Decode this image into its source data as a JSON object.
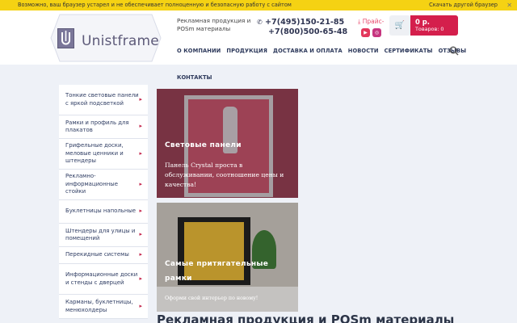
{
  "warning": {
    "message": "Возможно, ваш браузер устарел и не обеспечивает полноценную и безопасную работу с сайтом",
    "link": "Скачать другой браузер",
    "close": "✕"
  },
  "header": {
    "logo_text": "Unistframe",
    "tagline": "Рекламная продукция и POSm материалы",
    "phones": [
      "+7(495)150-21-85",
      "+7(800)500-65-48"
    ],
    "price_link": "Прайс-",
    "social_icons": [
      "youtube-icon",
      "instagram-icon"
    ],
    "cart": {
      "sum": "0 р.",
      "count": "Товаров: 0"
    }
  },
  "nav": {
    "items": [
      "О КОМПАНИИ",
      "ПРОДУКЦИЯ",
      "ДОСТАВКА И ОПЛАТА",
      "НОВОСТИ",
      "СЕРТИФИКАТЫ",
      "ОТЗЫВЫ"
    ],
    "second_row": "КОНТАКТЫ"
  },
  "sidebar": {
    "items": [
      "Тонкие световые панели с яркой подсветкой",
      "Рамки и профиль для плакатов",
      "Грифельные доски, меловые ценники и штендеры",
      "Рекламно-информационные стойки",
      "Буклетницы напольные",
      "Штендеры для улицы и помещений",
      "Перекидные системы",
      "Информационные доски и стенды с дверцей",
      "Карманы, буклетницы, менюхолдеры"
    ]
  },
  "banners": [
    {
      "title": "Световые панели",
      "description": "Панель Crystal проста в обслуживании, соотношение цены и качества!"
    },
    {
      "title": "Самые притягательные рамки",
      "description": "Оформи свой интерьер по новому!"
    }
  ],
  "main": {
    "title": "Рекламная продукция и POSm материалы"
  },
  "colors": {
    "accent": "#d41f4c",
    "warning_bg": "#f5d213",
    "nav_text": "#2e3a5c"
  }
}
